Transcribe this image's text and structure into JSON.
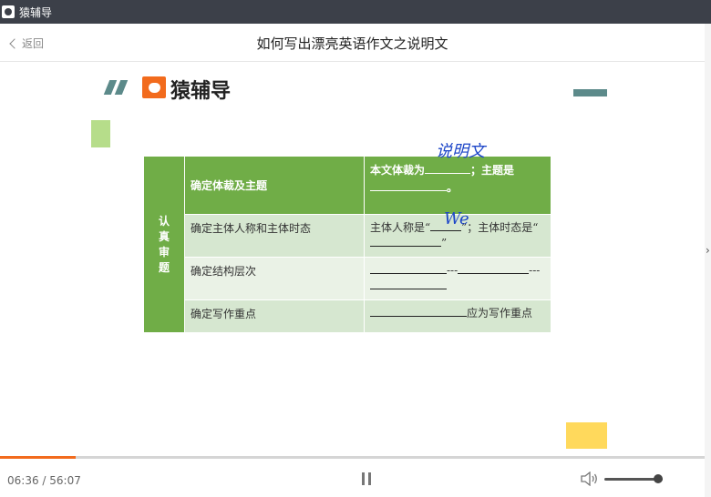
{
  "window": {
    "title": "猿辅导"
  },
  "header": {
    "back_label": "返回",
    "title": "如何写出漂亮英语作文之说明文"
  },
  "slide": {
    "logo_text": "猿辅导",
    "table": {
      "row_header": [
        "认",
        "真",
        "审",
        "题"
      ],
      "header_left": "确定体裁及主题",
      "header_right_prefix": "本文体裁为",
      "header_right_mid": "；主题是",
      "header_right_end": "。",
      "rows": [
        {
          "left": "确定主体人称和主体时态",
          "right_a": "主体人称是“",
          "right_b": "”；主体时态是“",
          "right_c": "”"
        },
        {
          "left": "确定结构层次",
          "sep": "---"
        },
        {
          "left": "确定写作重点",
          "right_tail": "应为写作重点"
        }
      ]
    },
    "handwriting": {
      "genre": "说明文",
      "person": "We"
    }
  },
  "player": {
    "time": "06:36 / 56:07",
    "progress": 0.108,
    "volume": 0.92
  },
  "colors": {
    "accent": "#f26b1d",
    "table_green": "#70ad47",
    "ink": "#1d46c8"
  }
}
